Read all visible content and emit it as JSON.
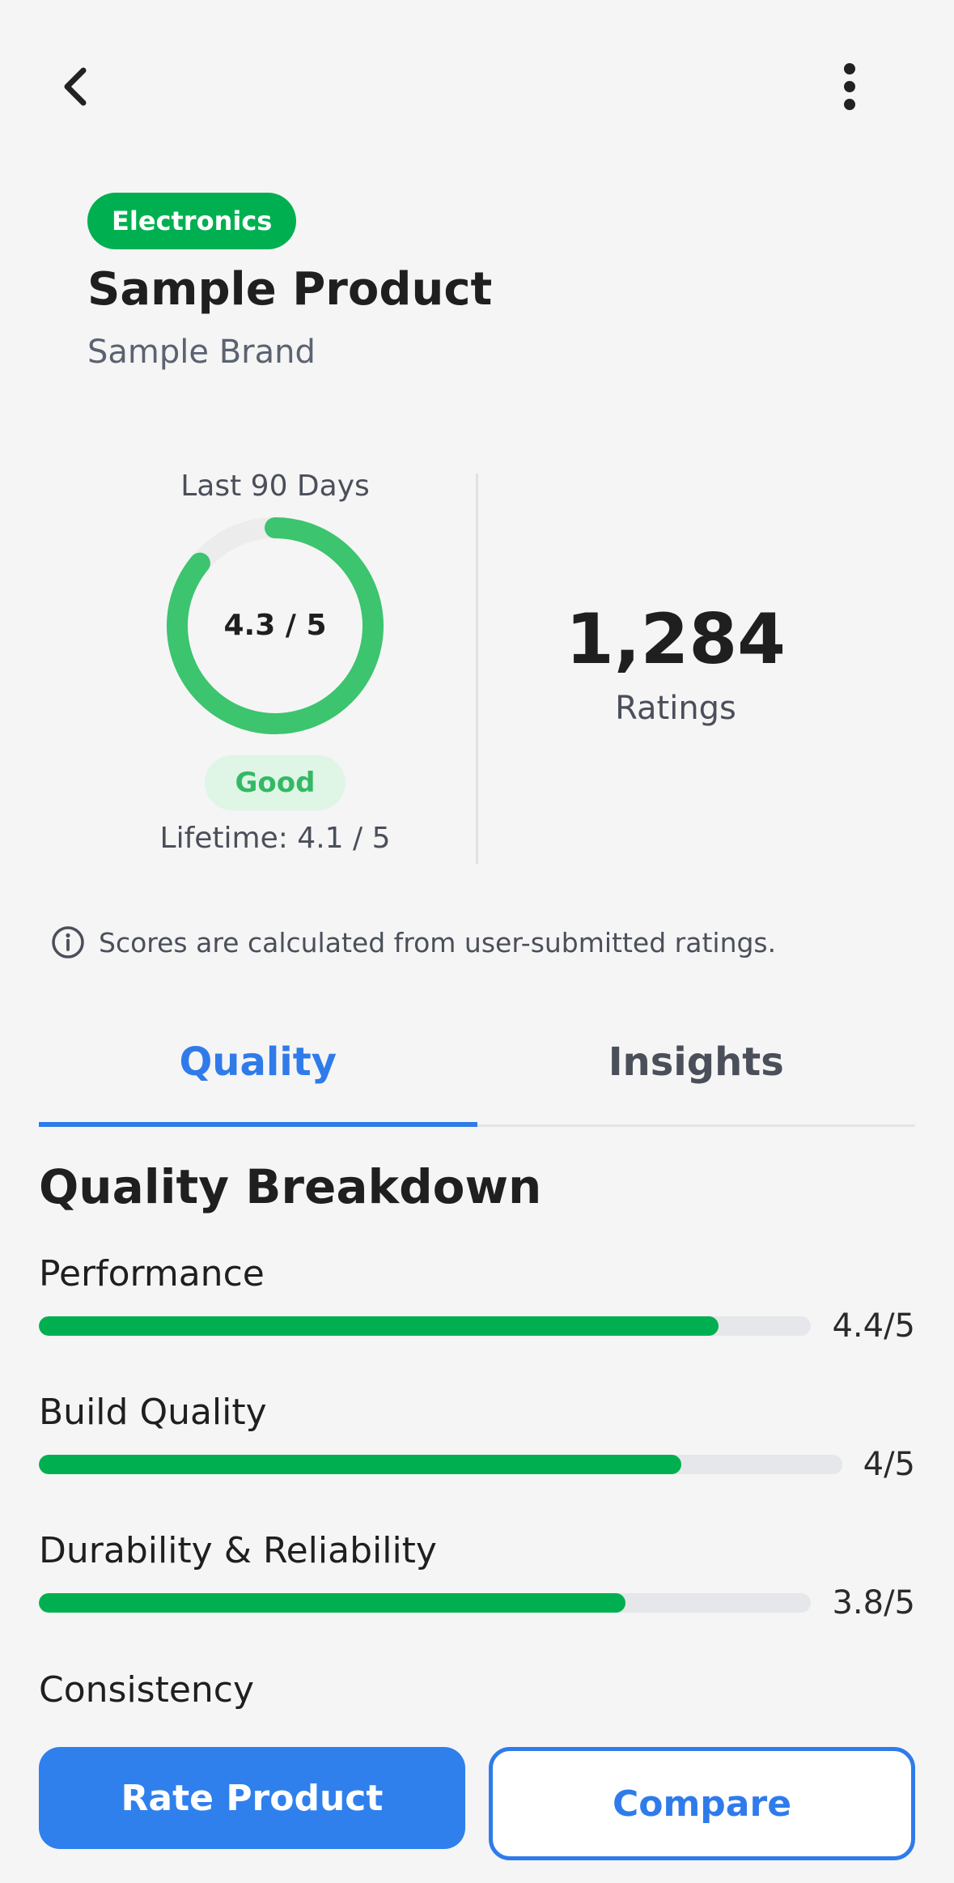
{
  "header": {
    "back_icon": "chevron-left-icon",
    "more_icon": "more-vertical-icon"
  },
  "product": {
    "category": "Electronics",
    "name": "Sample Product",
    "brand": "Sample Brand"
  },
  "score": {
    "period_label": "Last 90 Days",
    "value_text": "4.3 / 5",
    "value": 4.3,
    "max": 5,
    "rating_label": "Good",
    "lifetime_text": "Lifetime: 4.1 / 5",
    "ring_color": "#3cc46e"
  },
  "ratings": {
    "count": "1,284",
    "label": "Ratings"
  },
  "info": {
    "icon": "info-circle-icon",
    "text": "Scores are calculated from user-submitted ratings."
  },
  "tabs": [
    {
      "label": "Quality",
      "active": true
    },
    {
      "label": "Insights",
      "active": false
    }
  ],
  "breakdown": {
    "title": "Quality Breakdown",
    "metrics": [
      {
        "name": "Performance",
        "score_text": "4.4/5",
        "value": 4.4
      },
      {
        "name": "Build Quality",
        "score_text": "4/5",
        "value": 4.0
      },
      {
        "name": "Durability & Reliability",
        "score_text": "3.8/5",
        "value": 3.8
      },
      {
        "name": "Consistency"
      }
    ]
  },
  "actions": {
    "rate_label": "Rate Product",
    "compare_label": "Compare"
  },
  "colors": {
    "accent": "#2f7bea",
    "positive": "#00b050"
  }
}
